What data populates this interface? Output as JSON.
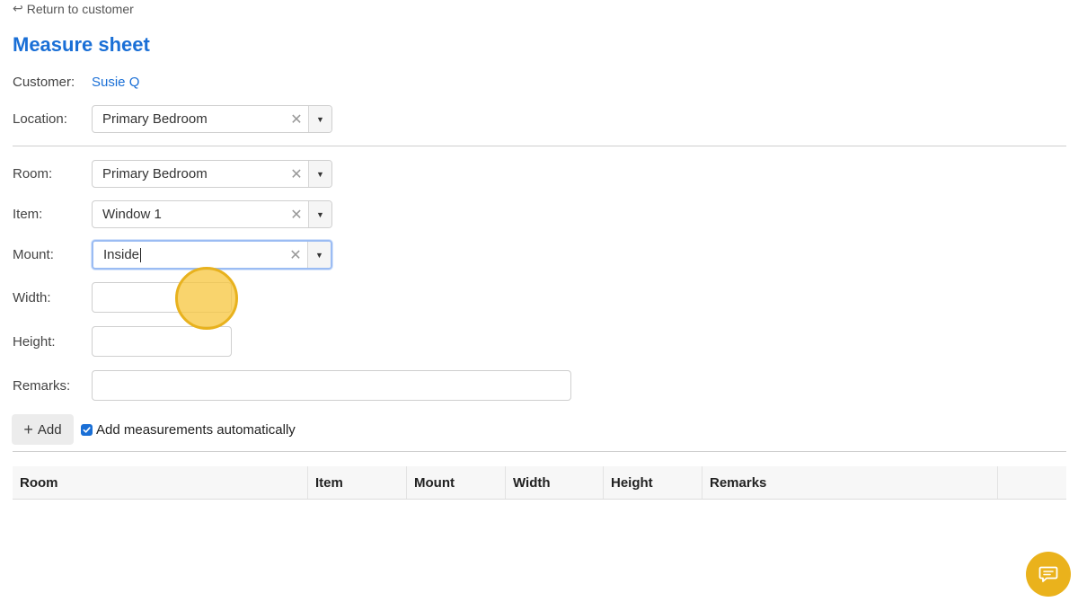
{
  "nav": {
    "back_label": "Return to customer"
  },
  "page": {
    "title": "Measure sheet"
  },
  "customer": {
    "label": "Customer:",
    "name": "Susie Q"
  },
  "location": {
    "label": "Location:",
    "value": "Primary Bedroom"
  },
  "form": {
    "room": {
      "label": "Room:",
      "value": "Primary Bedroom"
    },
    "item": {
      "label": "Item:",
      "value": "Window 1"
    },
    "mount": {
      "label": "Mount:",
      "value": "Inside"
    },
    "width": {
      "label": "Width:",
      "value": ""
    },
    "height": {
      "label": "Height:",
      "value": ""
    },
    "remarks": {
      "label": "Remarks:",
      "value": ""
    }
  },
  "actions": {
    "add_label": "Add",
    "auto_label": "Add measurements automatically",
    "auto_checked": true
  },
  "table": {
    "columns": [
      "Room",
      "Item",
      "Mount",
      "Width",
      "Height",
      "Remarks",
      ""
    ]
  },
  "icons": {
    "back": "return-arrow-icon",
    "clear": "clear-x-icon",
    "caret": "caret-down-icon",
    "plus": "plus-icon",
    "check": "checkmark-icon",
    "chat": "chat-icon"
  },
  "colors": {
    "accent": "#1a6fd6",
    "highlight": "#f7c63c",
    "chat": "#eab21c"
  }
}
